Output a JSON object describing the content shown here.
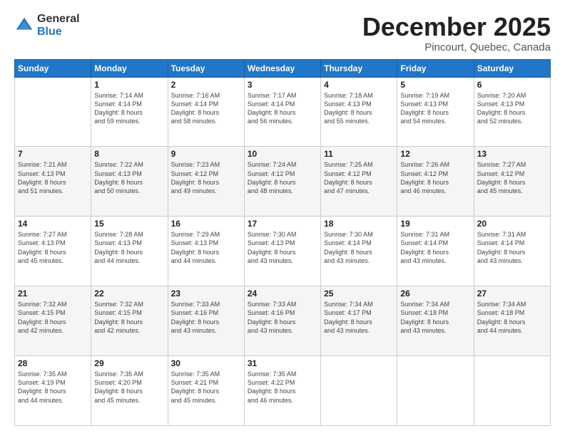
{
  "logo": {
    "general": "General",
    "blue": "Blue"
  },
  "title": "December 2025",
  "subtitle": "Pincourt, Quebec, Canada",
  "days_header": [
    "Sunday",
    "Monday",
    "Tuesday",
    "Wednesday",
    "Thursday",
    "Friday",
    "Saturday"
  ],
  "weeks": [
    [
      {
        "num": "",
        "info": ""
      },
      {
        "num": "1",
        "info": "Sunrise: 7:14 AM\nSunset: 4:14 PM\nDaylight: 8 hours\nand 59 minutes."
      },
      {
        "num": "2",
        "info": "Sunrise: 7:16 AM\nSunset: 4:14 PM\nDaylight: 8 hours\nand 58 minutes."
      },
      {
        "num": "3",
        "info": "Sunrise: 7:17 AM\nSunset: 4:14 PM\nDaylight: 8 hours\nand 56 minutes."
      },
      {
        "num": "4",
        "info": "Sunrise: 7:18 AM\nSunset: 4:13 PM\nDaylight: 8 hours\nand 55 minutes."
      },
      {
        "num": "5",
        "info": "Sunrise: 7:19 AM\nSunset: 4:13 PM\nDaylight: 8 hours\nand 54 minutes."
      },
      {
        "num": "6",
        "info": "Sunrise: 7:20 AM\nSunset: 4:13 PM\nDaylight: 8 hours\nand 52 minutes."
      }
    ],
    [
      {
        "num": "7",
        "info": "Sunrise: 7:21 AM\nSunset: 4:13 PM\nDaylight: 8 hours\nand 51 minutes."
      },
      {
        "num": "8",
        "info": "Sunrise: 7:22 AM\nSunset: 4:13 PM\nDaylight: 8 hours\nand 50 minutes."
      },
      {
        "num": "9",
        "info": "Sunrise: 7:23 AM\nSunset: 4:12 PM\nDaylight: 8 hours\nand 49 minutes."
      },
      {
        "num": "10",
        "info": "Sunrise: 7:24 AM\nSunset: 4:12 PM\nDaylight: 8 hours\nand 48 minutes."
      },
      {
        "num": "11",
        "info": "Sunrise: 7:25 AM\nSunset: 4:12 PM\nDaylight: 8 hours\nand 47 minutes."
      },
      {
        "num": "12",
        "info": "Sunrise: 7:26 AM\nSunset: 4:12 PM\nDaylight: 8 hours\nand 46 minutes."
      },
      {
        "num": "13",
        "info": "Sunrise: 7:27 AM\nSunset: 4:12 PM\nDaylight: 8 hours\nand 45 minutes."
      }
    ],
    [
      {
        "num": "14",
        "info": "Sunrise: 7:27 AM\nSunset: 4:13 PM\nDaylight: 8 hours\nand 45 minutes."
      },
      {
        "num": "15",
        "info": "Sunrise: 7:28 AM\nSunset: 4:13 PM\nDaylight: 8 hours\nand 44 minutes."
      },
      {
        "num": "16",
        "info": "Sunrise: 7:29 AM\nSunset: 4:13 PM\nDaylight: 8 hours\nand 44 minutes."
      },
      {
        "num": "17",
        "info": "Sunrise: 7:30 AM\nSunset: 4:13 PM\nDaylight: 8 hours\nand 43 minutes."
      },
      {
        "num": "18",
        "info": "Sunrise: 7:30 AM\nSunset: 4:14 PM\nDaylight: 8 hours\nand 43 minutes."
      },
      {
        "num": "19",
        "info": "Sunrise: 7:31 AM\nSunset: 4:14 PM\nDaylight: 8 hours\nand 43 minutes."
      },
      {
        "num": "20",
        "info": "Sunrise: 7:31 AM\nSunset: 4:14 PM\nDaylight: 8 hours\nand 43 minutes."
      }
    ],
    [
      {
        "num": "21",
        "info": "Sunrise: 7:32 AM\nSunset: 4:15 PM\nDaylight: 8 hours\nand 42 minutes."
      },
      {
        "num": "22",
        "info": "Sunrise: 7:32 AM\nSunset: 4:15 PM\nDaylight: 8 hours\nand 42 minutes."
      },
      {
        "num": "23",
        "info": "Sunrise: 7:33 AM\nSunset: 4:16 PM\nDaylight: 8 hours\nand 43 minutes."
      },
      {
        "num": "24",
        "info": "Sunrise: 7:33 AM\nSunset: 4:16 PM\nDaylight: 8 hours\nand 43 minutes."
      },
      {
        "num": "25",
        "info": "Sunrise: 7:34 AM\nSunset: 4:17 PM\nDaylight: 8 hours\nand 43 minutes."
      },
      {
        "num": "26",
        "info": "Sunrise: 7:34 AM\nSunset: 4:18 PM\nDaylight: 8 hours\nand 43 minutes."
      },
      {
        "num": "27",
        "info": "Sunrise: 7:34 AM\nSunset: 4:18 PM\nDaylight: 8 hours\nand 44 minutes."
      }
    ],
    [
      {
        "num": "28",
        "info": "Sunrise: 7:35 AM\nSunset: 4:19 PM\nDaylight: 8 hours\nand 44 minutes."
      },
      {
        "num": "29",
        "info": "Sunrise: 7:35 AM\nSunset: 4:20 PM\nDaylight: 8 hours\nand 45 minutes."
      },
      {
        "num": "30",
        "info": "Sunrise: 7:35 AM\nSunset: 4:21 PM\nDaylight: 8 hours\nand 45 minutes."
      },
      {
        "num": "31",
        "info": "Sunrise: 7:35 AM\nSunset: 4:22 PM\nDaylight: 8 hours\nand 46 minutes."
      },
      {
        "num": "",
        "info": ""
      },
      {
        "num": "",
        "info": ""
      },
      {
        "num": "",
        "info": ""
      }
    ]
  ]
}
